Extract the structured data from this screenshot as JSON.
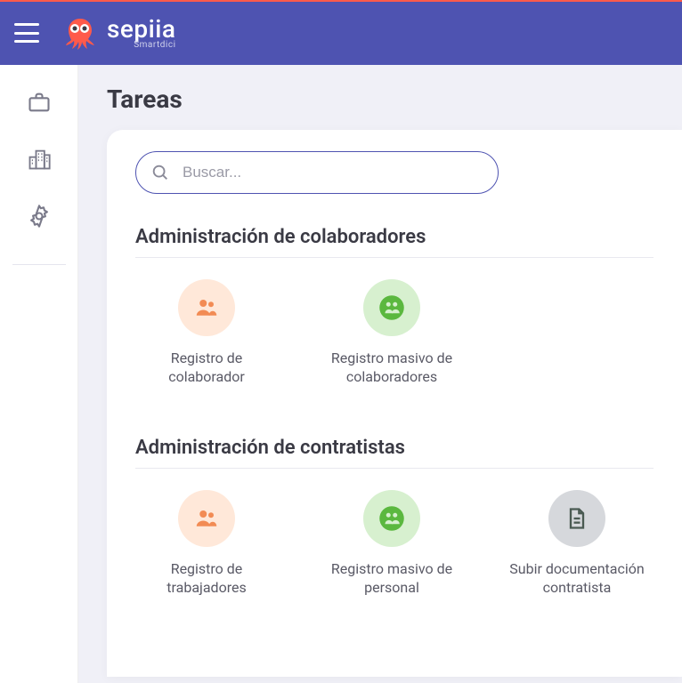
{
  "brand": {
    "name": "sepiia",
    "tagline": "Smartdici"
  },
  "page": {
    "title": "Tareas"
  },
  "search": {
    "placeholder": "Buscar..."
  },
  "sections": [
    {
      "title": "Administración de colaboradores",
      "items": [
        {
          "label": "Registro de colaborador"
        },
        {
          "label": "Registro masivo de colaboradores"
        }
      ]
    },
    {
      "title": "Administración de contratistas",
      "items": [
        {
          "label": "Registro de trabajadores"
        },
        {
          "label": "Registro masivo de personal"
        },
        {
          "label": "Subir documentación contratista"
        }
      ]
    }
  ]
}
